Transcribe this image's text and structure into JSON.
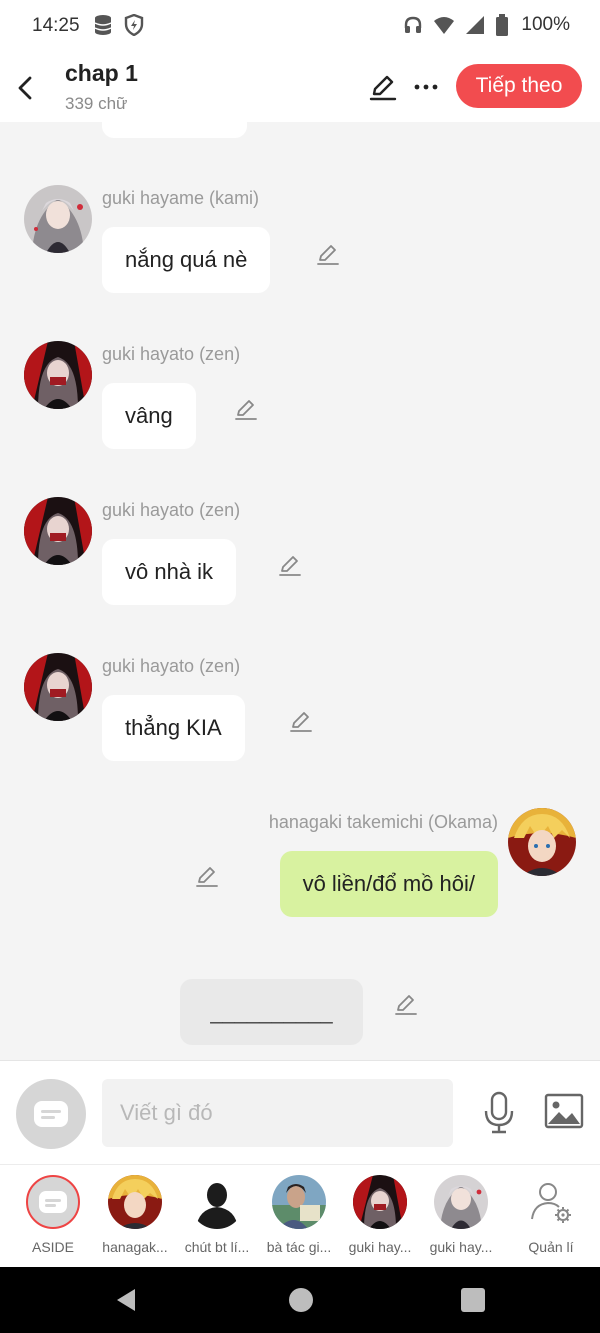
{
  "status_bar": {
    "time": "14:25",
    "battery_text": "100%",
    "icons": [
      "database-icon",
      "shield-icon",
      "headphones-icon",
      "wifi-icon",
      "signal-icon",
      "battery-icon"
    ]
  },
  "header": {
    "title": "chap 1",
    "subtitle": "339 chữ",
    "next_label": "Tiếp theo",
    "accent_color": "#f24c4f"
  },
  "messages": [
    {
      "sender": "guki hayame (kami)",
      "text": "nắng quá nè",
      "side": "left",
      "avatar": "avatar-hayame"
    },
    {
      "sender": "guki hayato (zen)",
      "text": "vâng",
      "side": "left",
      "avatar": "avatar-hayato"
    },
    {
      "sender": "guki hayato (zen)",
      "text": "vô nhà ik",
      "side": "left",
      "avatar": "avatar-hayato"
    },
    {
      "sender": "guki hayato (zen)",
      "text": "thẳng KIA",
      "side": "left",
      "avatar": "avatar-hayato"
    },
    {
      "sender": "hanagaki takemichi (Okama)",
      "text": "vô liền/đổ mồ hôi/",
      "side": "right",
      "avatar": "avatar-takemichi"
    }
  ],
  "narration": {
    "text": "__________"
  },
  "input": {
    "placeholder": "Viết gì đó"
  },
  "characters": [
    {
      "name": "ASIDE"
    },
    {
      "name": "hanagak..."
    },
    {
      "name": "chút bt lí..."
    },
    {
      "name": "bà tác gi..."
    },
    {
      "name": "guki hay..."
    },
    {
      "name": "guki hay..."
    },
    {
      "name": "Quản lí"
    }
  ],
  "colors": {
    "my_bubble": "#d8f2a0",
    "other_bubble": "#ffffff",
    "background": "#f4f4f4"
  }
}
